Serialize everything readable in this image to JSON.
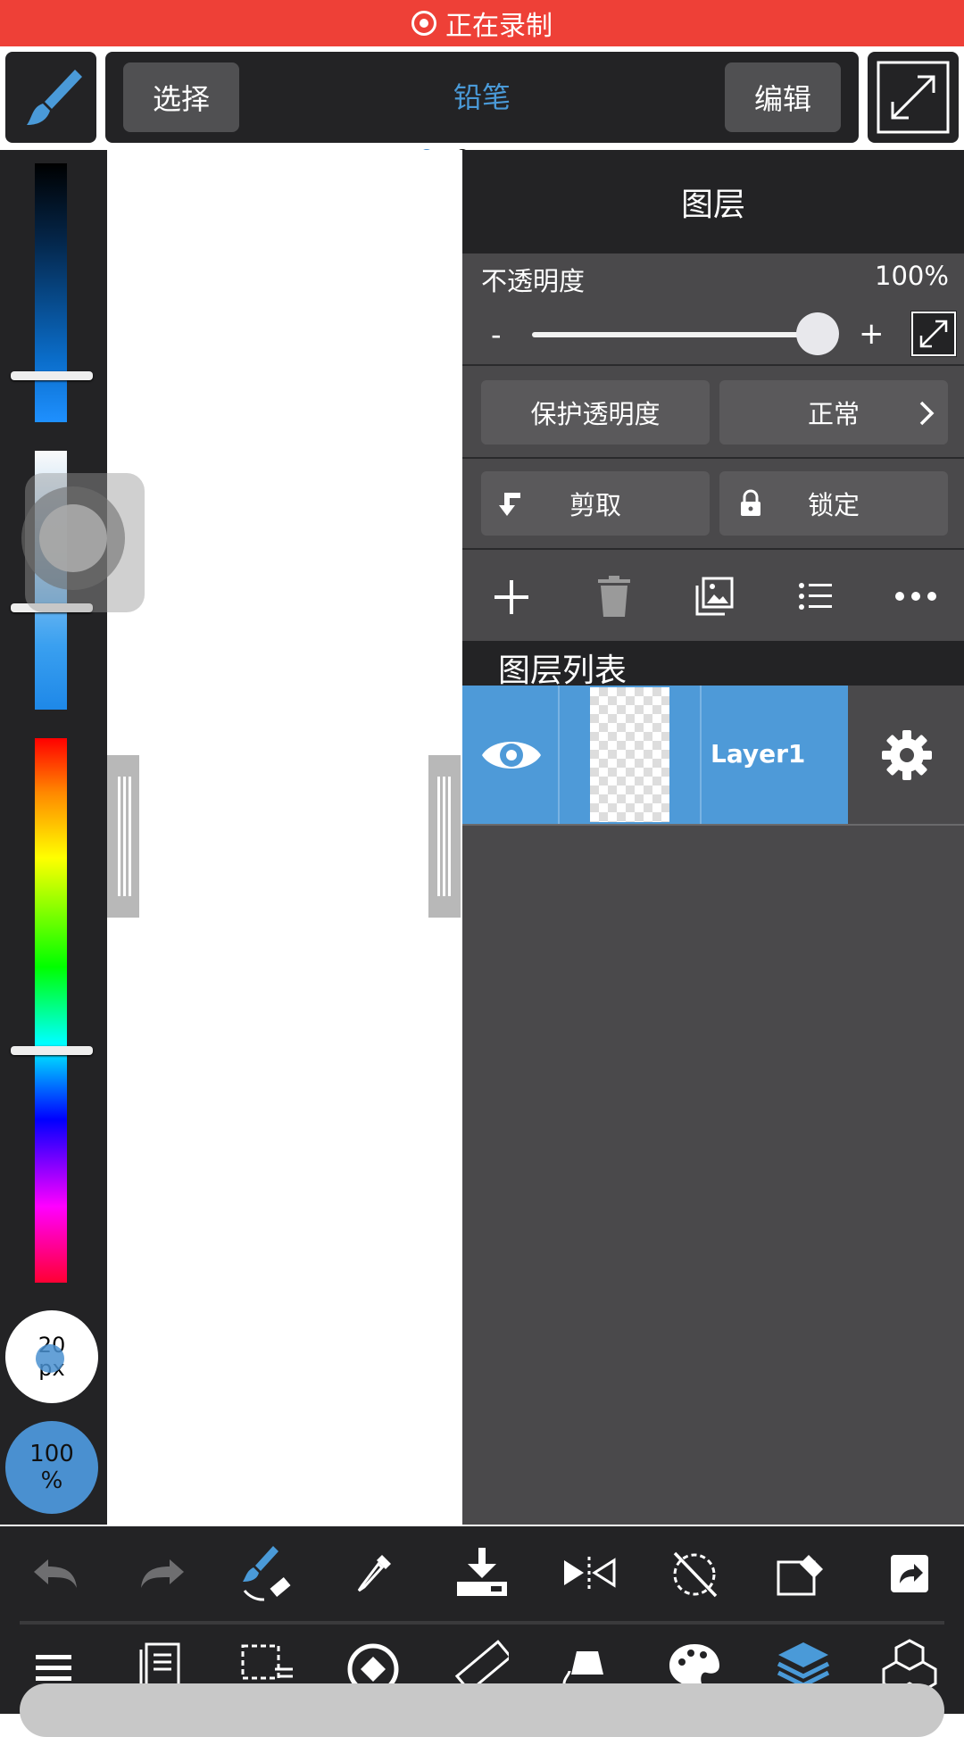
{
  "status_bar": {
    "recording_label": "正在录制"
  },
  "toolbar": {
    "select_label": "选择",
    "tool_name": "铅笔",
    "edit_label": "编辑"
  },
  "brush": {
    "size_value": "20",
    "size_unit": "px",
    "opacity_value": "100",
    "opacity_unit": "%"
  },
  "layer_panel": {
    "title": "图层",
    "opacity_label": "不透明度",
    "opacity_value": "100%",
    "opacity_fraction": 1.0,
    "minus": "-",
    "plus": "+",
    "protect_alpha_label": "保护透明度",
    "blend_mode_label": "正常",
    "clip_label": "剪取",
    "lock_label": "锁定",
    "list_title": "图层列表",
    "layers": [
      {
        "name": "Layer1",
        "visible": true
      }
    ]
  },
  "colors": {
    "accent": "#4a9ad8",
    "recording_red": "#ee4037",
    "panel_dark": "#232325",
    "panel_gray": "#4a494b"
  },
  "icons": {
    "toolbar": [
      "brush-icon",
      "fullscreen-icon"
    ],
    "layer_actions": [
      "add-layer-icon",
      "delete-layer-icon",
      "layer-image-icon",
      "layer-list-icon",
      "more-icon"
    ],
    "bottom_row1": [
      "undo-icon",
      "redo-icon",
      "brush-eraser-icon",
      "eyedropper-icon",
      "save-icon",
      "flip-icon",
      "rotate-icon",
      "transform-icon",
      "share-icon"
    ],
    "bottom_row2": [
      "menu-icon",
      "pages-icon",
      "selection-icon",
      "navigator-icon",
      "ruler-icon",
      "fill-icon",
      "palette-icon",
      "layers-icon",
      "3d-model-icon"
    ]
  }
}
